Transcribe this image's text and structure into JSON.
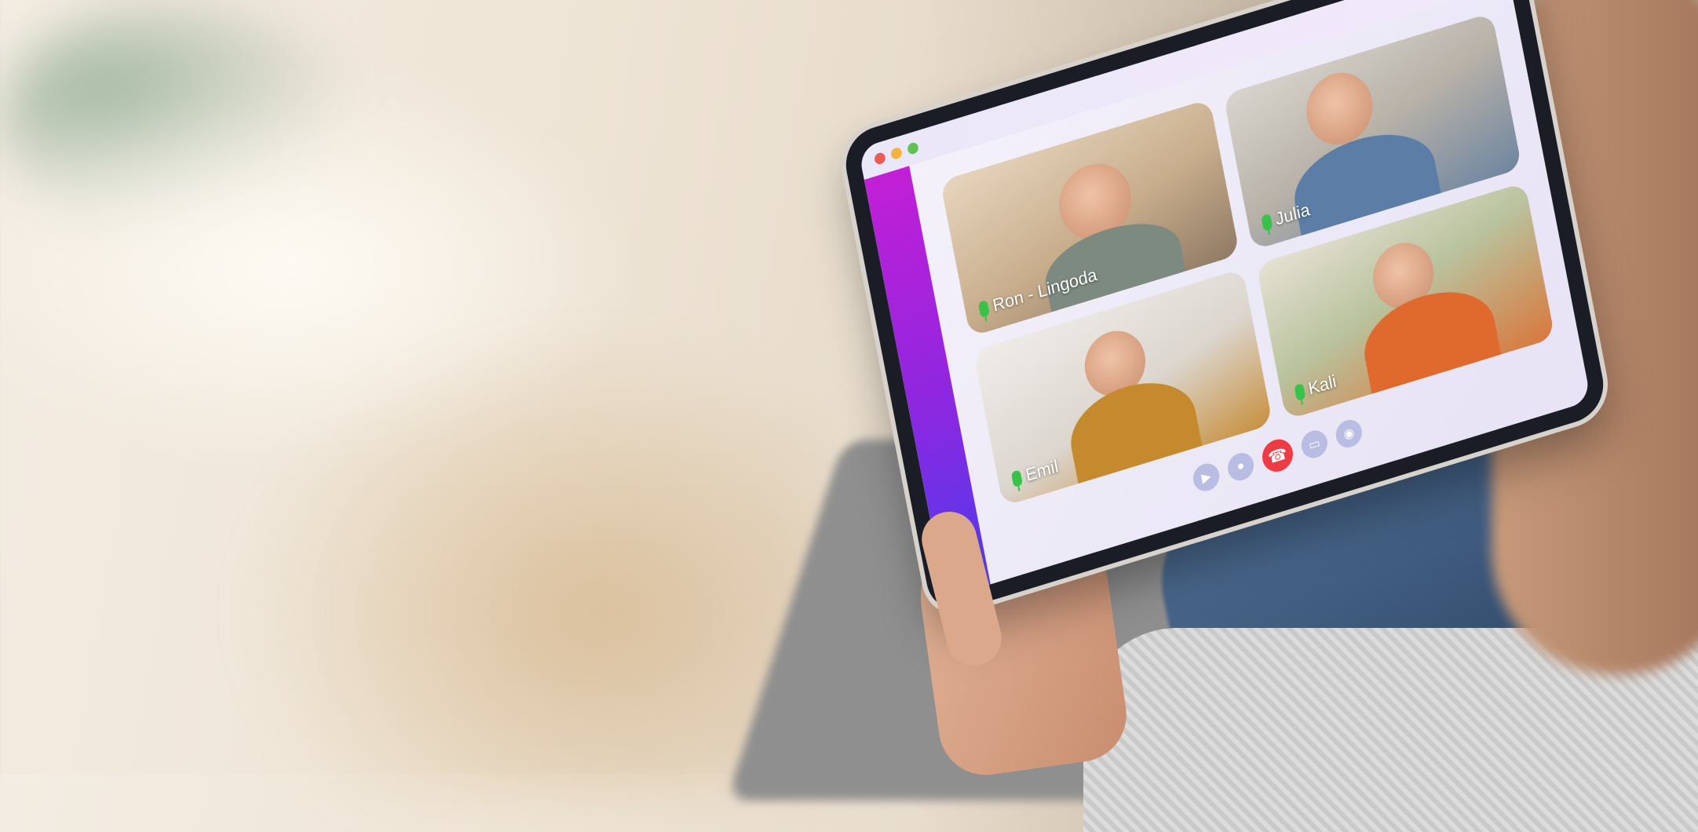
{
  "window": {
    "traffic_lights": [
      "close",
      "minimize",
      "maximize"
    ]
  },
  "app": {
    "logo_icon": "lingoda-logo-icon",
    "accent_gradient": [
      "#c21fd6",
      "#4f3bea"
    ]
  },
  "participants": [
    {
      "name": "Ron - Lingoda",
      "mic_status": "on"
    },
    {
      "name": "Julia",
      "mic_status": "on"
    },
    {
      "name": "Emil",
      "mic_status": "on"
    },
    {
      "name": "Kali",
      "mic_status": "on"
    }
  ],
  "controls": [
    {
      "icon": "camera-icon"
    },
    {
      "icon": "microphone-icon"
    },
    {
      "icon": "end-call-icon",
      "color": "#ef3b44"
    },
    {
      "icon": "chat-icon"
    },
    {
      "icon": "more-icon"
    }
  ]
}
